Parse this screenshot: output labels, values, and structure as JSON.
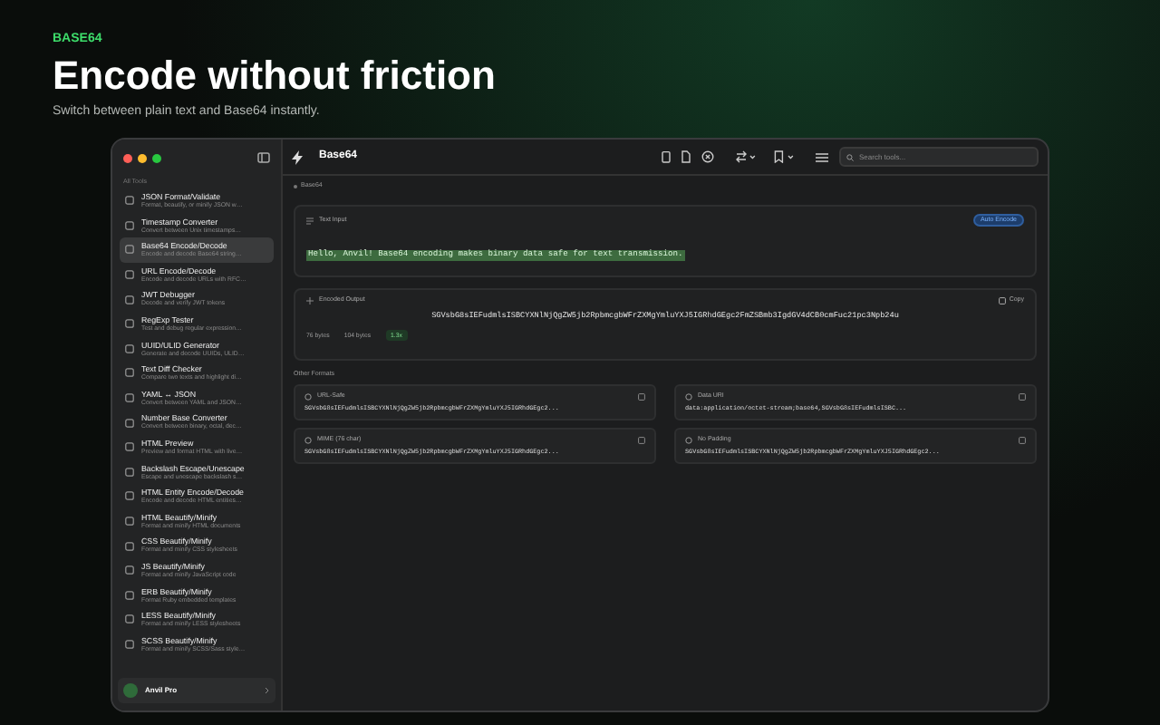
{
  "hero": {
    "eyebrow": "BASE64",
    "title": "Encode without friction",
    "subtitle": "Switch between plain text and Base64 instantly."
  },
  "sidebar": {
    "section": "All Tools",
    "items": [
      {
        "title": "JSON Format/Validate",
        "description": "Format, beautify, or minify JSON w…",
        "selected": false
      },
      {
        "title": "Timestamp Converter",
        "description": "Convert between Unix timestamps…",
        "selected": false
      },
      {
        "title": "Base64 Encode/Decode",
        "description": "Encode and decode Base64 string…",
        "selected": true
      },
      {
        "title": "URL Encode/Decode",
        "description": "Encode and decode URLs with RFC…",
        "selected": false
      },
      {
        "title": "JWT Debugger",
        "description": "Decode and verify JWT tokens",
        "selected": false
      },
      {
        "title": "RegExp Tester",
        "description": "Test and debug regular expression…",
        "selected": false
      },
      {
        "title": "UUID/ULID Generator",
        "description": "Generate and decode UUIDs, ULID…",
        "selected": false
      },
      {
        "title": "Text Diff Checker",
        "description": "Compare two texts and highlight di…",
        "selected": false
      },
      {
        "title": "YAML ↔ JSON",
        "description": "Convert between YAML and JSON…",
        "selected": false
      },
      {
        "title": "Number Base Converter",
        "description": "Convert between binary, octal, dec…",
        "selected": false
      },
      {
        "title": "HTML Preview",
        "description": "Preview and format HTML with live…",
        "selected": false
      },
      {
        "title": "Backslash Escape/Unescape",
        "description": "Escape and unescape backslash s…",
        "selected": false
      },
      {
        "title": "HTML Entity Encode/Decode",
        "description": "Encode and decode HTML entities…",
        "selected": false
      },
      {
        "title": "HTML Beautify/Minify",
        "description": "Format and minify HTML documents",
        "selected": false
      },
      {
        "title": "CSS Beautify/Minify",
        "description": "Format and minify CSS stylesheets",
        "selected": false
      },
      {
        "title": "JS Beautify/Minify",
        "description": "Format and minify JavaScript code",
        "selected": false
      },
      {
        "title": "ERB Beautify/Minify",
        "description": "Format Ruby embedded templates",
        "selected": false
      },
      {
        "title": "LESS Beautify/Minify",
        "description": "Format and minify LESS stylesheets",
        "selected": false
      },
      {
        "title": "SCSS Beautify/Minify",
        "description": "Format and minify SCSS/Sass style…",
        "selected": false
      }
    ],
    "user": {
      "name": "Anvil Pro"
    }
  },
  "toolbar": {
    "title": "Base64",
    "search_placeholder": "Search tools..."
  },
  "breadcrumb": "Base64",
  "input": {
    "label": "Text Input",
    "badge": "Auto Encode",
    "value": "Hello, Anvil! Base64 encoding makes binary data safe for text transmission."
  },
  "output": {
    "label": "Encoded Output",
    "copy": "Copy",
    "value": "SGVsbG8sIEFudmlsISBCYXNlNjQgZW5jb2RpbmcgbWFrZXMgYmluYXJ5IGRhdGEgc2FmZSBmb3IgdGV4dCB0cmFuc21pc3Npb24u",
    "stats": [
      "76 bytes",
      "104 bytes",
      "1.3x"
    ]
  },
  "other_formats": {
    "title": "Other Formats",
    "items": [
      {
        "label": "URL-Safe",
        "value": "SGVsbG8sIEFudmlsISBCYXNlNjQgZW5jb2RpbmcgbWFrZXMgYmluYXJ5IGRhdGEgc2..."
      },
      {
        "label": "Data URI",
        "value": "data:application/octet-stream;base64,SGVsbG8sIEFudmlsISBC..."
      },
      {
        "label": "MIME (76 char)",
        "value": "SGVsbG8sIEFudmlsISBCYXNlNjQgZW5jb2RpbmcgbWFrZXMgYmluYXJ5IGRhdGEgc2..."
      },
      {
        "label": "No Padding",
        "value": "SGVsbG8sIEFudmlsISBCYXNlNjQgZW5jb2RpbmcgbWFrZXMgYmluYXJ5IGRhdGEgc2..."
      }
    ]
  }
}
